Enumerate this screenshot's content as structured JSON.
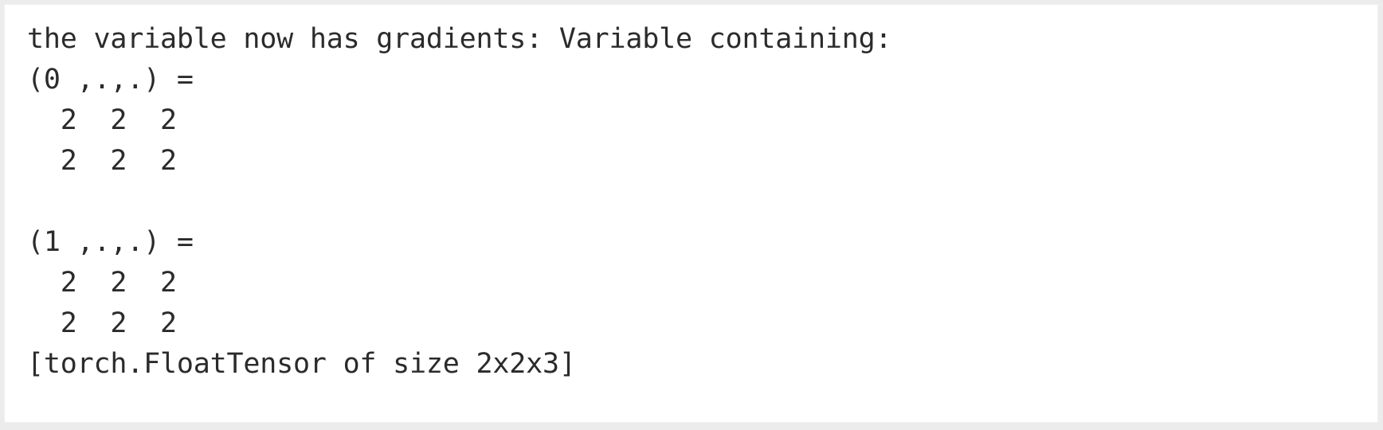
{
  "window": {
    "type": "console-output-block",
    "background_color": "#ececec",
    "card_color": "#ffffff",
    "text_color": "#2b2b2b"
  },
  "console": {
    "name": "pytorch-gradient-output",
    "lines": [
      {
        "id": "line-header",
        "text": "the variable now has gradients: Variable containing:",
        "kind": "text"
      },
      {
        "id": "line-slice-0",
        "text": "(0 ,.,.) = ",
        "kind": "slice-header"
      },
      {
        "id": "line-0-row-0",
        "text": "  2  2  2",
        "kind": "data-row"
      },
      {
        "id": "line-0-row-1",
        "text": "  2  2  2",
        "kind": "data-row"
      },
      {
        "id": "line-blank",
        "text": "",
        "kind": "blank"
      },
      {
        "id": "line-slice-1",
        "text": "(1 ,.,.) = ",
        "kind": "slice-header"
      },
      {
        "id": "line-1-row-0",
        "text": "  2  2  2",
        "kind": "data-row"
      },
      {
        "id": "line-1-row-1",
        "text": "  2  2  2",
        "kind": "data-row"
      },
      {
        "id": "line-footer",
        "text": "[torch.FloatTensor of size 2x2x3]",
        "kind": "tensor-info"
      }
    ],
    "tensor": {
      "dtype": "torch.FloatTensor",
      "size": "2x2x3",
      "slice_labels": [
        "(0 ,.,.) =",
        "(1 ,.,.) ="
      ],
      "values": [
        [
          [
            2,
            2,
            2
          ],
          [
            2,
            2,
            2
          ]
        ],
        [
          [
            2,
            2,
            2
          ],
          [
            2,
            2,
            2
          ]
        ]
      ]
    }
  }
}
